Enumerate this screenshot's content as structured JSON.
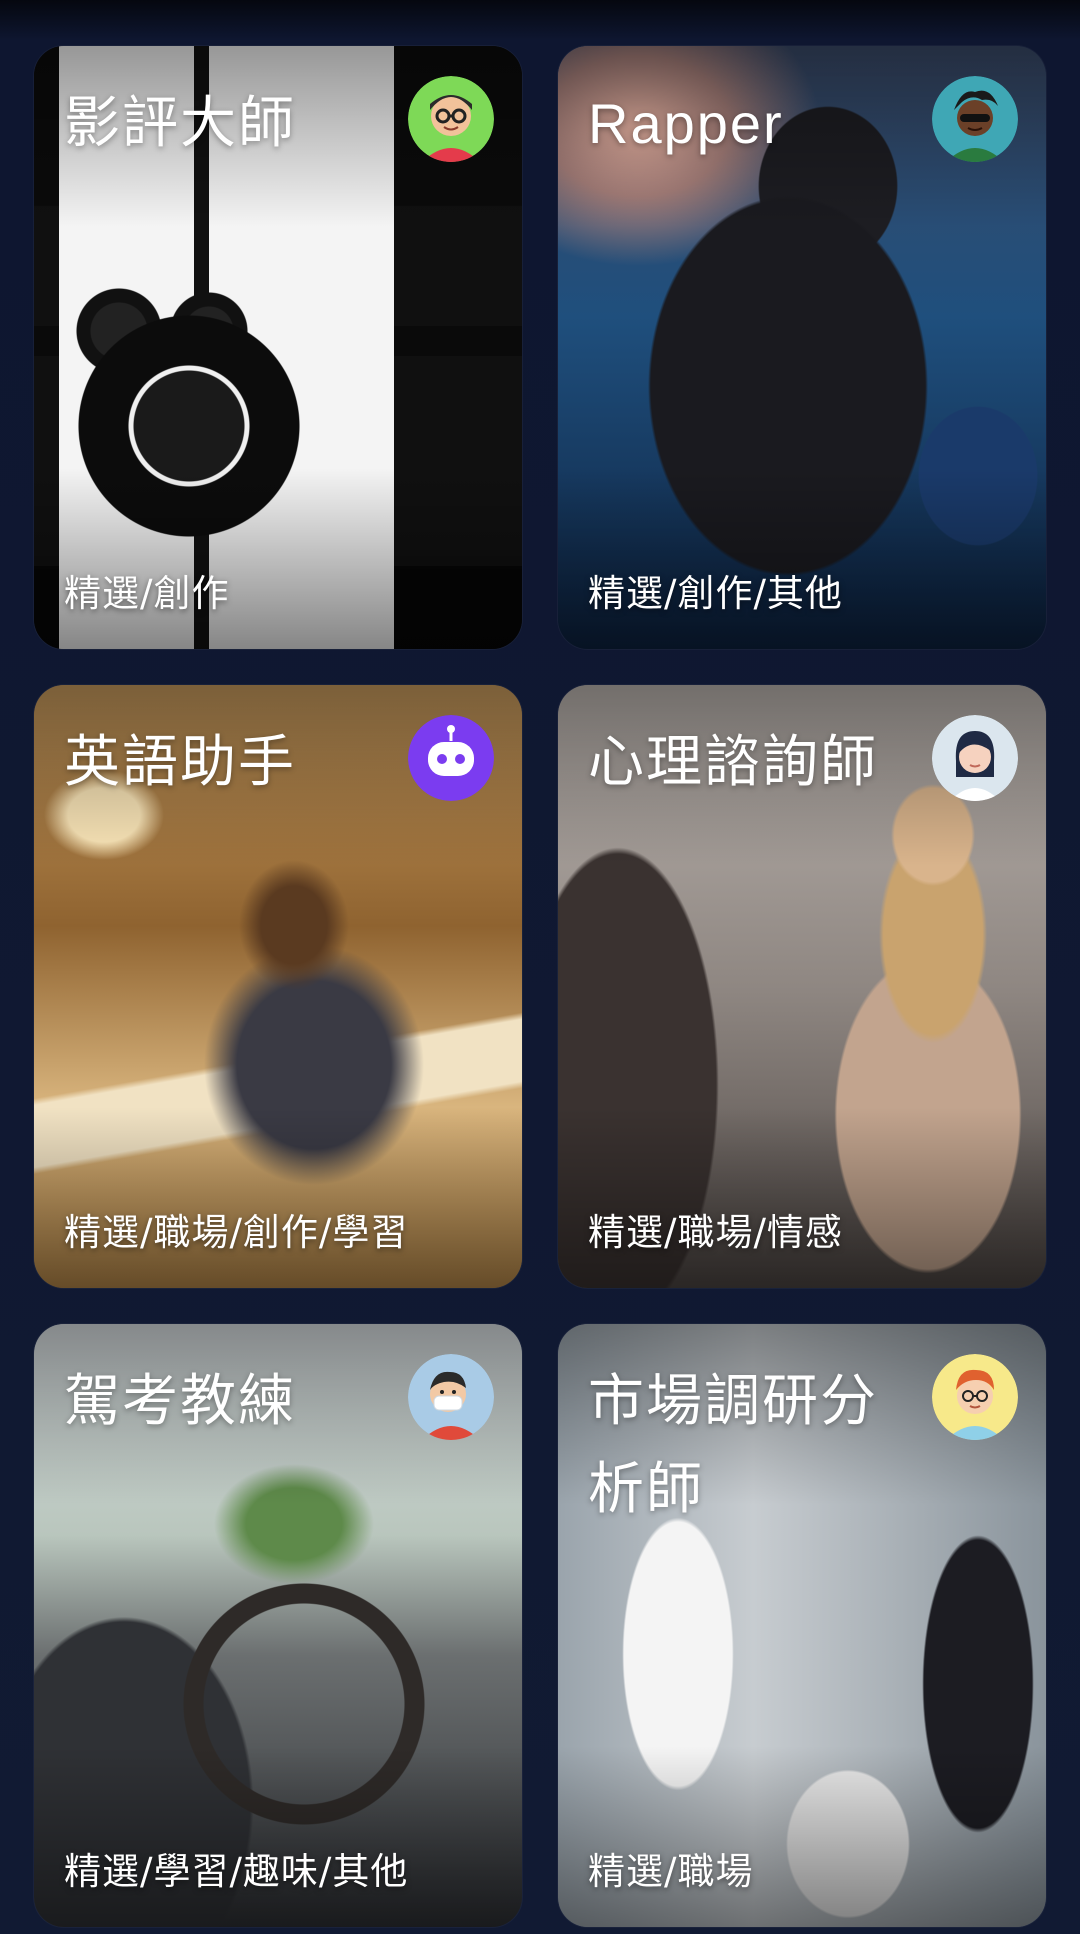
{
  "cards": [
    {
      "title": "影評大師",
      "tags": "精選/創作",
      "avatar_icon": "avatar-glasses-man-icon"
    },
    {
      "title": "Rapper",
      "tags": "精選/創作/其他",
      "avatar_icon": "avatar-rapper-icon"
    },
    {
      "title": "英語助手",
      "tags": "精選/職場/創作/學習",
      "avatar_icon": "robot-icon"
    },
    {
      "title": "心理諮詢師",
      "tags": "精選/職場/情感",
      "avatar_icon": "avatar-woman-icon"
    },
    {
      "title": "駕考教練",
      "tags": "精選/學習/趣味/其他",
      "avatar_icon": "avatar-masked-man-icon"
    },
    {
      "title": "市場調研分析師",
      "tags": "精選/職場",
      "avatar_icon": "avatar-redhair-man-icon"
    }
  ],
  "colors": {
    "background": "#111a33",
    "text": "#ffffff",
    "robot_avatar_bg": "#7b3cf0"
  }
}
